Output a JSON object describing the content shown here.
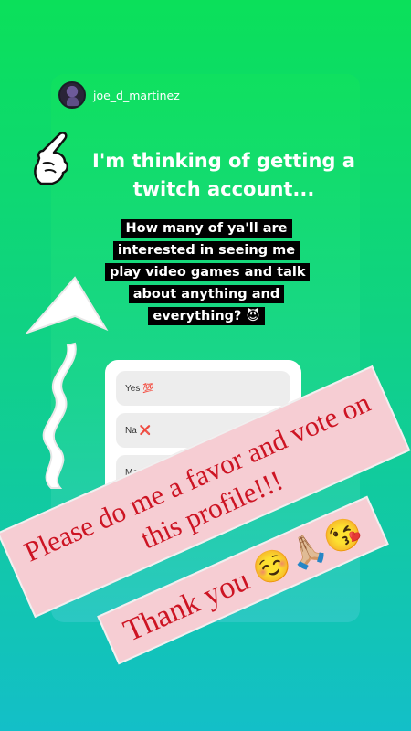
{
  "story": {
    "username": "joe_d_martinez",
    "headline": "I'm thinking of getting a twitch account...",
    "question": "How many of ya'll are interested in seeing me play video games and talk about anything and everything? 😈"
  },
  "poll": {
    "options": [
      "Yes 💯",
      "Na ❌",
      "Maybe 🤷"
    ]
  },
  "stickers": {
    "favor": "Please do me a favor and vote on this profile!!!",
    "thanks": "Thank you ☺️🙏🏼😘"
  },
  "colors": {
    "gradient_top": "#0be05a",
    "gradient_bottom": "#13bfc8",
    "ribbon_fill": "#f6cdd3",
    "ribbon_text": "#cd1423"
  }
}
